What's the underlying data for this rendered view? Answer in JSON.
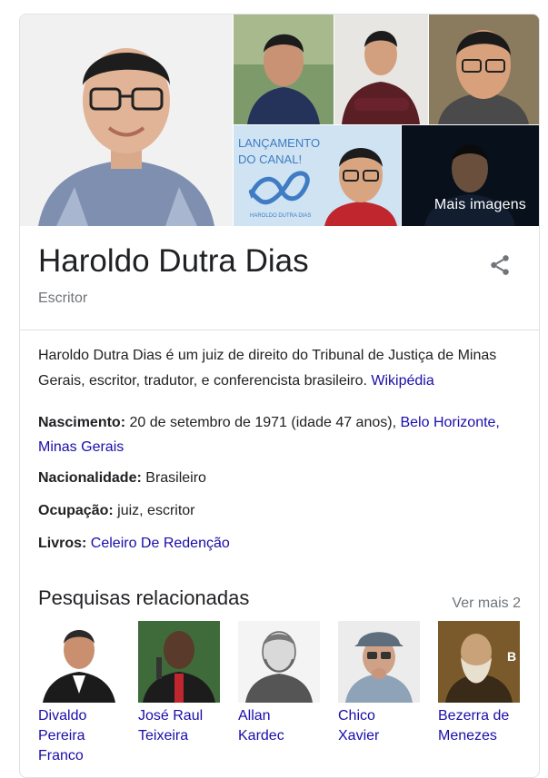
{
  "gallery": {
    "more_images_label": "Mais imagens",
    "banner_line1": "LANÇAMENTO",
    "banner_line2": "DO CANAL!",
    "banner_small": "HAROLDO DUTRA DIAS"
  },
  "header": {
    "title": "Haroldo Dutra Dias",
    "subtitle": "Escritor",
    "share_icon": "share-icon"
  },
  "description": {
    "text": "Haroldo Dutra Dias é um juiz de direito do Tribunal de Justiça de Minas Gerais, escritor, tradutor, e conferencista brasileiro.",
    "source_link": "Wikipédia"
  },
  "facts": {
    "birth_label": "Nascimento:",
    "birth_value": "20 de setembro de 1971 (idade 47 anos),",
    "birth_place_link": "Belo Horizonte, Minas Gerais",
    "nationality_label": "Nacionalidade:",
    "nationality_value": "Brasileiro",
    "occupation_label": "Ocupação:",
    "occupation_value": "juiz, escritor",
    "books_label": "Livros:",
    "books_link": "Celeiro De Redenção"
  },
  "related": {
    "title": "Pesquisas relacionadas",
    "more_link": "Ver mais 2",
    "items": [
      {
        "name": "Divaldo Pereira Franco"
      },
      {
        "name": "José Raul Teixeira"
      },
      {
        "name": "Allan Kardec"
      },
      {
        "name": "Chico Xavier"
      },
      {
        "name": "Bezerra de Menezes"
      }
    ]
  },
  "colors": {
    "link": "#1a0dab",
    "secondary_text": "#70757a",
    "border": "#dfe1e5",
    "banner_blue": "#3f7cc4"
  }
}
